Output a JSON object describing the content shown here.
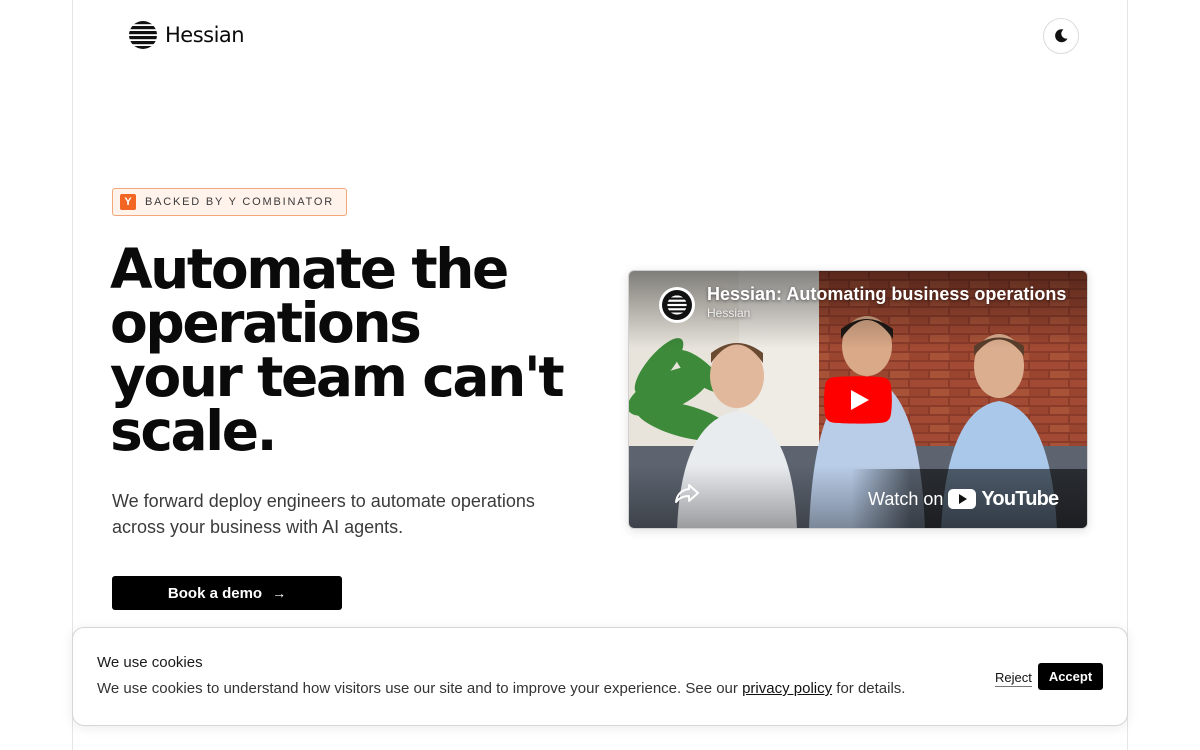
{
  "header": {
    "brand": "Hessian"
  },
  "hero": {
    "badge_letter": "Y",
    "badge_text": "BACKED BY Y COMBINATOR",
    "headline_lines": [
      "Automate the",
      "operations",
      "your team can't",
      "scale."
    ],
    "subhead": "We forward deploy engineers to automate operations across your business with AI agents.",
    "cta_label": "Book a demo",
    "cta_arrow": "→"
  },
  "video": {
    "title": "Hessian: Automating business operations",
    "channel": "Hessian",
    "watch_on": "Watch on",
    "youtube_word": "YouTube"
  },
  "cookie": {
    "title": "We use cookies",
    "body_before": "We use cookies to understand how visitors use our site and to improve your experience. See our ",
    "link": "privacy policy",
    "body_after": " for details.",
    "reject": "Reject",
    "accept": "Accept"
  },
  "colors": {
    "accent": "#000000",
    "yc_orange": "#f26522",
    "badge_bg": "#fff3ec",
    "youtube_red": "#ff0000"
  },
  "icons": {
    "logo": "hessian-logo-icon",
    "theme": "moon-icon",
    "play": "play-icon",
    "share": "share-icon"
  }
}
